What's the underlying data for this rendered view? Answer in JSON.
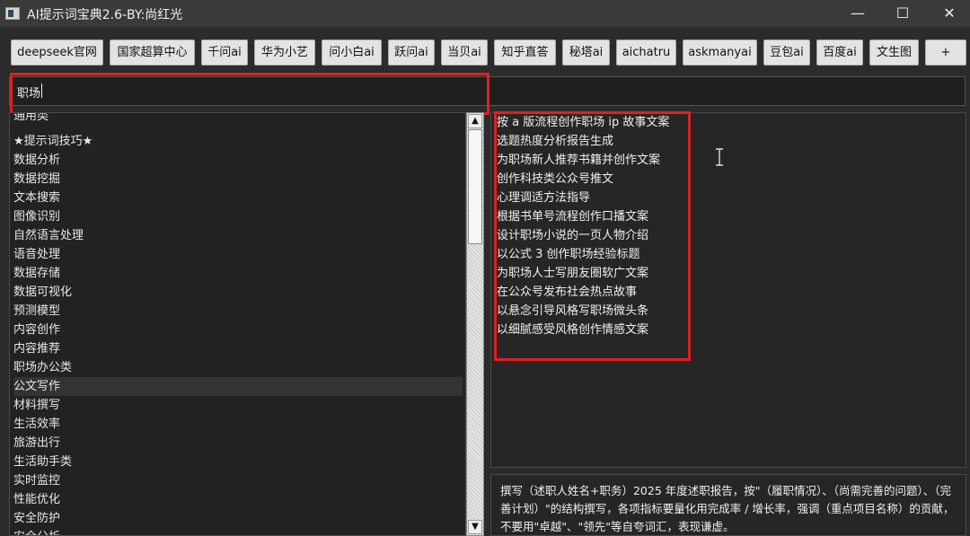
{
  "window": {
    "title": "AI提示词宝典2.6-BY:尚红光",
    "minimize": "—",
    "maximize": "☐",
    "close": "✕"
  },
  "toolbar": {
    "buttons": [
      "deepseek官网",
      "国家超算中心",
      "千问ai",
      "华为小艺",
      "问小白ai",
      "跃问ai",
      "当贝ai",
      "知乎直答",
      "秘塔ai",
      "aichatru",
      "askmanyai",
      "豆包ai",
      "百度ai",
      "文生图",
      "+"
    ]
  },
  "search": {
    "value": "职场"
  },
  "categories": {
    "items": [
      "通用类",
      "★提示词技巧★",
      "数据分析",
      "数据挖掘",
      "文本搜索",
      "图像识别",
      "自然语言处理",
      "语音处理",
      "数据存储",
      "数据可视化",
      "预测模型",
      "内容创作",
      "内容推荐",
      "职场办公类",
      "公文写作",
      "材料撰写",
      "生活效率",
      "旅游出行",
      "生活助手类",
      "实时监控",
      "性能优化",
      "安全防护",
      "安全分析"
    ],
    "selected_index": 14
  },
  "scrollbar": {
    "up": "▲",
    "down": "▼"
  },
  "prompts": {
    "items": [
      "按 a 版流程创作职场 ip 故事文案",
      "选题热度分析报告生成",
      "为职场新人推荐书籍并创作文案",
      "创作科技类公众号推文",
      "心理调适方法指导",
      "根据书单号流程创作口播文案",
      "设计职场小说的一页人物介绍",
      "以公式 3 创作职场经验标题",
      "为职场人士写朋友圈软广文案",
      "在公众号发布社会热点故事",
      "以悬念引导风格写职场微头条",
      "以细腻感受风格创作情感文案"
    ]
  },
  "detail": {
    "text": "撰写（述职人姓名+职务）2025 年度述职报告，按\"（履职情况）、（尚需完善的问题）、（完善计划）\"的结构撰写，各项指标要量化用完成率 / 增长率，强调（重点项目名称）的贡献，不要用\"卓越\"、\"领先\"等自夸词汇，表现谦虚。"
  },
  "colors": {
    "highlight_box": "#e02020",
    "background": "#2b2b2b"
  }
}
